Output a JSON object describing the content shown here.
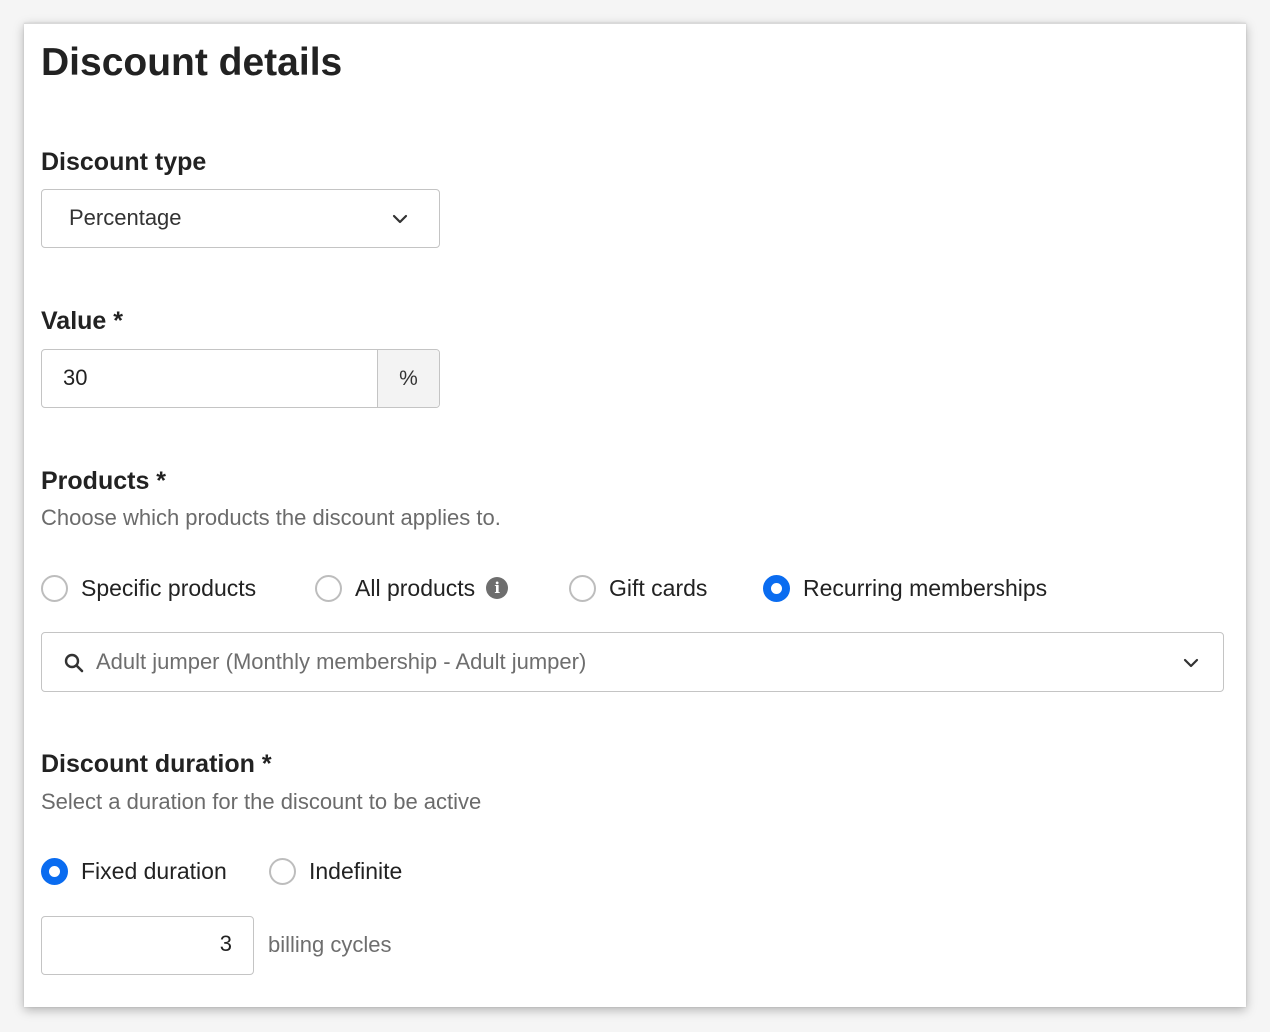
{
  "card": {
    "title": "Discount details"
  },
  "discount_type": {
    "label": "Discount type",
    "selected": "Percentage"
  },
  "value": {
    "label": "Value *",
    "amount": "30",
    "unit": "%"
  },
  "products": {
    "label": "Products *",
    "help": "Choose which products the discount applies to.",
    "options": [
      {
        "label": "Specific products",
        "checked": false
      },
      {
        "label": "All products",
        "checked": false,
        "info_icon": "info-icon"
      },
      {
        "label": "Gift cards",
        "checked": false
      },
      {
        "label": "Recurring memberships",
        "checked": true
      }
    ],
    "search": {
      "value": "Adult jumper (Monthly membership - Adult jumper)",
      "icon": "search-icon"
    }
  },
  "duration": {
    "label": "Discount duration *",
    "help": "Select a duration for the discount to be active",
    "options": [
      {
        "label": "Fixed duration",
        "checked": true
      },
      {
        "label": "Indefinite",
        "checked": false
      }
    ],
    "cycles_value": "3",
    "cycles_suffix": "billing cycles"
  },
  "colors": {
    "accent": "#0a6cf0",
    "border": "#c4c4c4",
    "text": "#222222",
    "muted": "#6b6b6b"
  }
}
